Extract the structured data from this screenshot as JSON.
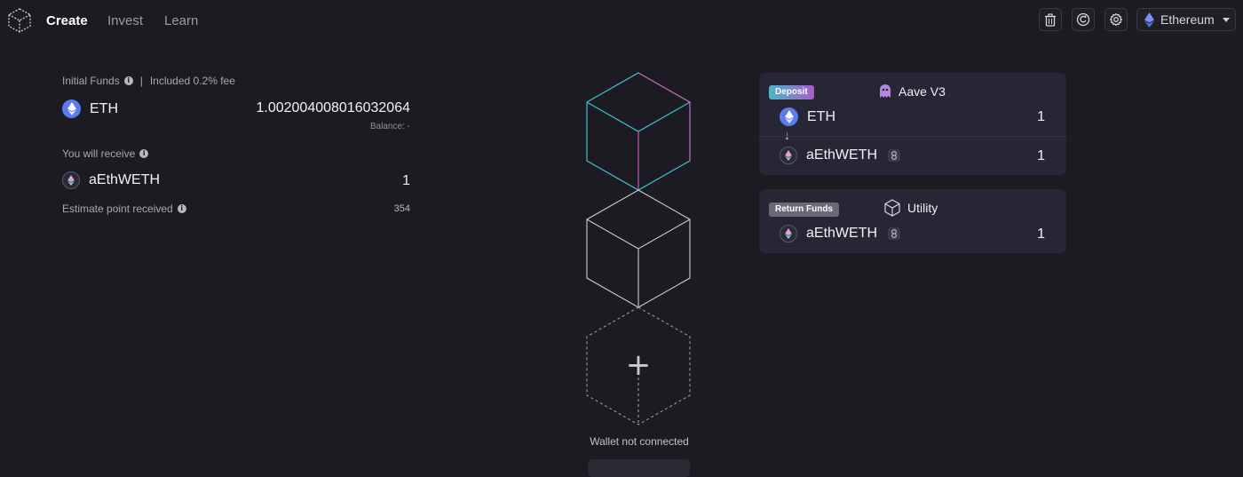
{
  "nav": {
    "links": [
      {
        "label": "Create",
        "active": true
      },
      {
        "label": "Invest",
        "active": false
      },
      {
        "label": "Learn",
        "active": false
      }
    ],
    "icons": [
      "trash-icon",
      "refresh-icon",
      "gear-icon"
    ],
    "network": {
      "label": "Ethereum",
      "icon": "ethereum-icon"
    }
  },
  "left": {
    "initial_funds_label": "Initial Funds",
    "separator": "|",
    "fee_text": "Included 0.2% fee",
    "input_token": {
      "symbol": "ETH",
      "amount": "1.002004008016032064"
    },
    "balance_text": "Balance: -",
    "receive_label": "You will receive",
    "output_token": {
      "symbol": "aEthWETH",
      "amount": "1"
    },
    "points_label": "Estimate point received",
    "points_value": "354"
  },
  "center": {
    "wallet_status": "Wallet not connected",
    "add_symbol": "+"
  },
  "cards": {
    "deposit": {
      "badge": "Deposit",
      "protocol": "Aave V3",
      "in_token": {
        "symbol": "ETH",
        "amount": "1"
      },
      "arrow": "↓",
      "out_token": {
        "symbol": "aEthWETH",
        "amount": "1"
      }
    },
    "return": {
      "badge": "Return Funds",
      "protocol": "Utility",
      "token": {
        "symbol": "aEthWETH",
        "amount": "1"
      }
    }
  },
  "colors": {
    "background": "#1b1b21",
    "card": "#262634",
    "accent_cyan": "#3fc1d3",
    "accent_pink": "#c25fb0",
    "eth_blue": "#5b7cf0"
  }
}
